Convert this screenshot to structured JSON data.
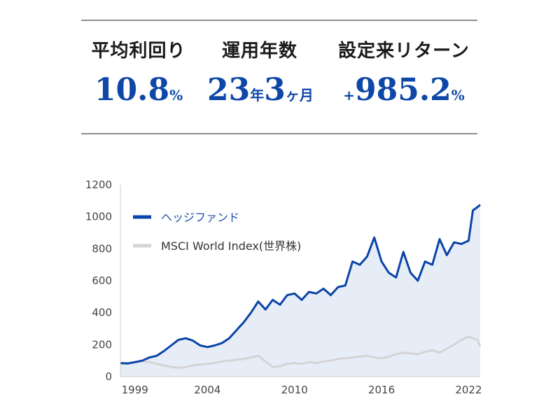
{
  "stats": [
    {
      "label": "平均利回り",
      "value": "10.8",
      "unit": "%"
    },
    {
      "label": "運用年数",
      "years": "23",
      "years_unit": "年",
      "months": "3",
      "months_unit": "ヶ月"
    },
    {
      "label": "設定来リターン",
      "prefix": "+",
      "value": "985.2",
      "unit": "%"
    }
  ],
  "colors": {
    "accent": "#0d47a8",
    "series1": "#0b44a8",
    "series1_fill": "#e6edf7",
    "series2": "#d4d4d4",
    "rule": "#8f8f8f"
  },
  "chart_data": {
    "type": "line",
    "legend_position": "top-left",
    "grid": false,
    "xlim": [
      1998.0,
      2022.8
    ],
    "ylim": [
      0,
      1200
    ],
    "x_ticks": [
      {
        "value": 1999,
        "label": "1999"
      },
      {
        "value": 2004,
        "label": "2004"
      },
      {
        "value": 2010,
        "label": "2010"
      },
      {
        "value": 2016,
        "label": "2016"
      },
      {
        "value": 2022,
        "label": "2022"
      }
    ],
    "y_ticks": [
      {
        "value": 0,
        "label": "0"
      },
      {
        "value": 200,
        "label": "200"
      },
      {
        "value": 400,
        "label": "400"
      },
      {
        "value": 600,
        "label": "600"
      },
      {
        "value": 800,
        "label": "800"
      },
      {
        "value": 1000,
        "label": "1000"
      },
      {
        "value": 1200,
        "label": "1200"
      }
    ],
    "series": [
      {
        "name": "ヘッジファンド",
        "x": [
          1998.0,
          1998.5,
          1999.0,
          1999.5,
          2000.0,
          2000.5,
          2001.0,
          2001.5,
          2002.0,
          2002.5,
          2003.0,
          2003.5,
          2004.0,
          2004.5,
          2005.0,
          2005.5,
          2006.0,
          2006.5,
          2007.0,
          2007.5,
          2008.0,
          2008.5,
          2009.0,
          2009.5,
          2010.0,
          2010.5,
          2011.0,
          2011.5,
          2012.0,
          2012.5,
          2013.0,
          2013.5,
          2014.0,
          2014.5,
          2015.0,
          2015.5,
          2016.0,
          2016.5,
          2017.0,
          2017.5,
          2018.0,
          2018.5,
          2019.0,
          2019.5,
          2020.0,
          2020.5,
          2021.0,
          2021.5,
          2022.0,
          2022.3,
          2022.6,
          2022.8
        ],
        "values": [
          85,
          82,
          90,
          100,
          120,
          130,
          160,
          195,
          230,
          240,
          225,
          195,
          185,
          195,
          210,
          240,
          290,
          340,
          400,
          470,
          420,
          480,
          450,
          510,
          520,
          480,
          530,
          520,
          550,
          510,
          560,
          570,
          720,
          700,
          750,
          870,
          720,
          650,
          620,
          780,
          650,
          600,
          720,
          700,
          860,
          760,
          840,
          830,
          850,
          1040,
          1060,
          1075
        ]
      },
      {
        "name": "MSCI World Index(世界株)",
        "x": [
          1998.0,
          1998.5,
          1999.0,
          1999.5,
          2000.0,
          2000.5,
          2001.0,
          2001.5,
          2002.0,
          2002.5,
          2003.0,
          2003.5,
          2004.0,
          2004.5,
          2005.0,
          2005.5,
          2006.0,
          2006.5,
          2007.0,
          2007.5,
          2008.0,
          2008.5,
          2009.0,
          2009.5,
          2010.0,
          2010.5,
          2011.0,
          2011.5,
          2012.0,
          2012.5,
          2013.0,
          2013.5,
          2014.0,
          2014.5,
          2015.0,
          2015.5,
          2016.0,
          2016.5,
          2017.0,
          2017.5,
          2018.0,
          2018.5,
          2019.0,
          2019.5,
          2020.0,
          2020.5,
          2021.0,
          2021.5,
          2022.0,
          2022.3,
          2022.6,
          2022.8
        ],
        "values": [
          80,
          85,
          90,
          95,
          90,
          80,
          70,
          60,
          55,
          60,
          70,
          75,
          80,
          85,
          95,
          100,
          105,
          110,
          120,
          130,
          95,
          60,
          65,
          80,
          85,
          80,
          90,
          85,
          95,
          100,
          110,
          115,
          120,
          125,
          130,
          120,
          115,
          125,
          140,
          150,
          145,
          140,
          155,
          165,
          150,
          175,
          200,
          230,
          250,
          240,
          230,
          190
        ]
      }
    ]
  }
}
